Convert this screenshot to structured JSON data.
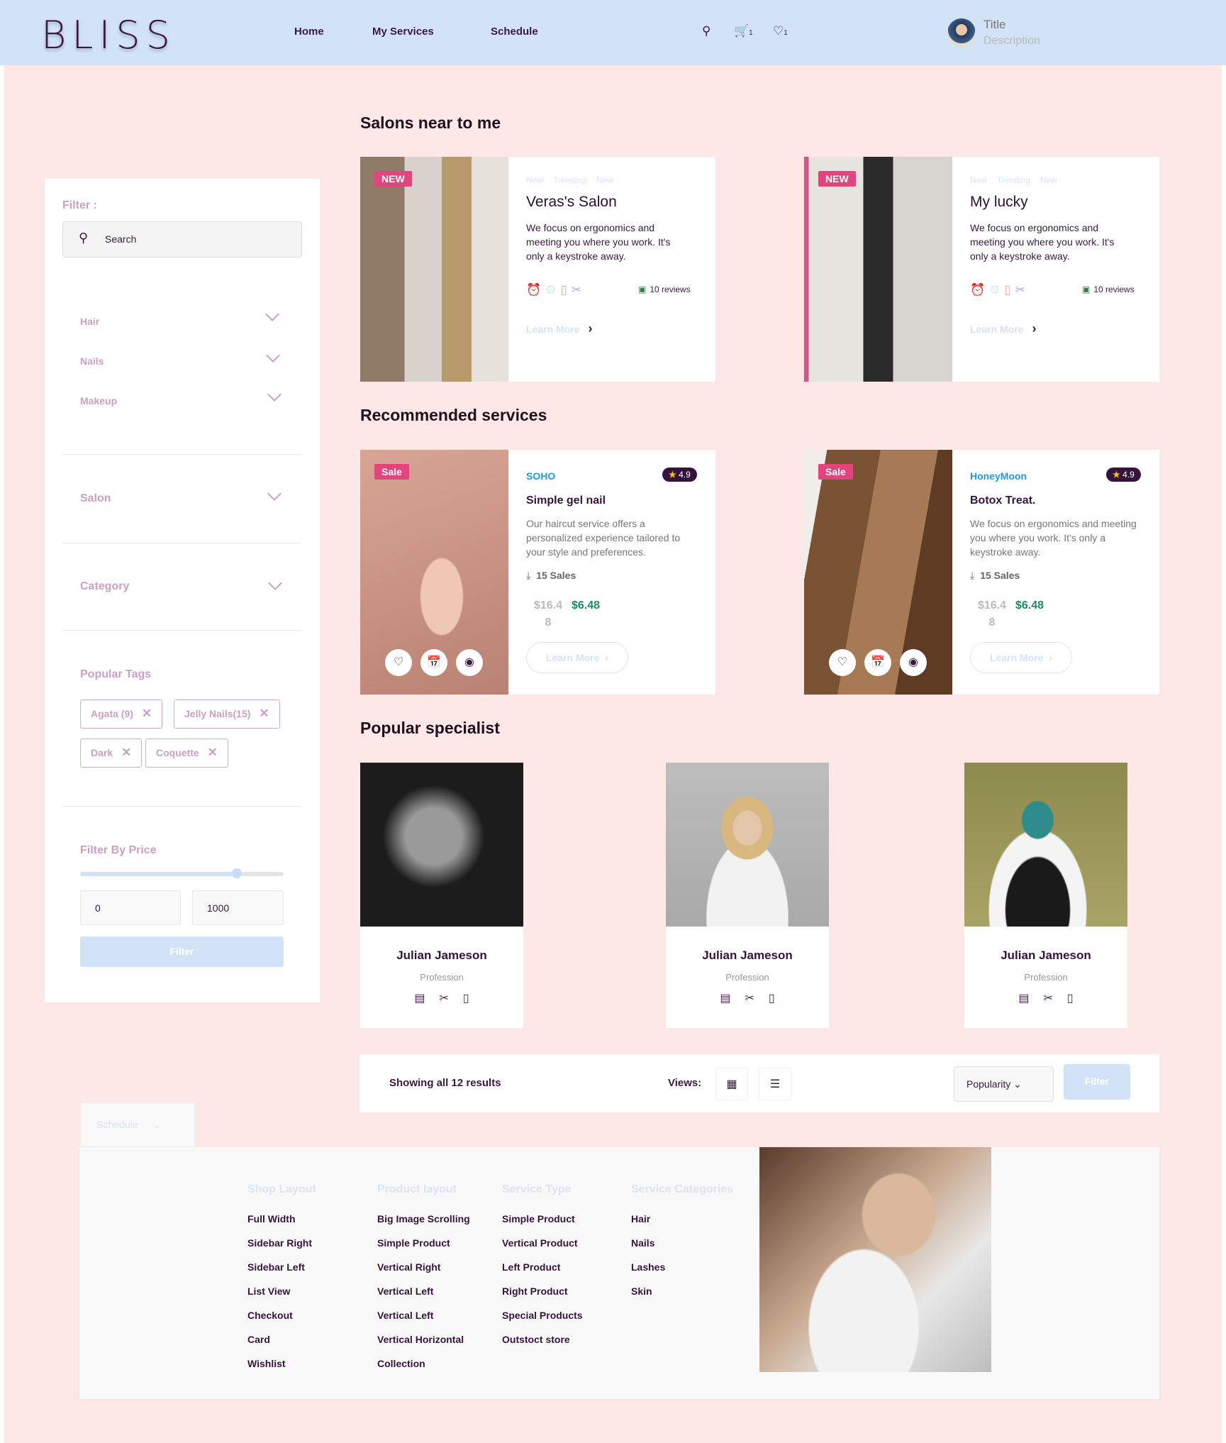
{
  "header": {
    "logo": "BLISS",
    "nav": [
      "Home",
      "My Services",
      "Schedule"
    ],
    "cart_count": "1",
    "wishlist_count": "1",
    "user_title": "Title",
    "user_description": "Description"
  },
  "sidebar": {
    "filter_label": "Filter :",
    "search_placeholder": "Search",
    "groups": [
      "Hair",
      "Nails",
      "Makeup"
    ],
    "salon": "Salon",
    "category": "Category",
    "popular_tags_label": "Popular Tags",
    "tags": [
      "Agata (9)",
      "Jelly Nails(15)",
      "Dark",
      "Coquette"
    ],
    "price_label": "Filter By Price",
    "price_fraction": 0.77,
    "min": "0",
    "max": "1000",
    "filter_button": "Filter"
  },
  "salons": {
    "heading": "Salons near to me",
    "items": [
      {
        "badge": "NEW",
        "tags": [
          "New",
          "Trending",
          "New"
        ],
        "name": "Veras's Salon",
        "description": "We focus on ergonomics and meeting you where you work. It's only a keystroke away.",
        "reviews": "10 reviews",
        "cta": "Learn More"
      },
      {
        "badge": "NEW",
        "tags": [
          "New",
          "Trending",
          "New"
        ],
        "name": "My lucky",
        "description": "We focus on ergonomics and meeting you where you work. It's only a keystroke away.",
        "reviews": "10 reviews",
        "cta": "Learn More"
      }
    ]
  },
  "services": {
    "heading": "Recommended services",
    "items": [
      {
        "badge": "Sale",
        "brand": "SOHO",
        "rating": "4.9",
        "name": "Simple gel nail",
        "description": "Our haircut service offers a personalized experience tailored to your style and preferences.",
        "sales": "15 Sales",
        "old_price": "$16.48",
        "price": "$6.48",
        "cta": "Learn More"
      },
      {
        "badge": "Sale",
        "brand": "HoneyMoon",
        "rating": "4.9",
        "name": "Botox Treat.",
        "description": "We focus on ergonomics and meeting you where you work. It's only a keystroke away.",
        "sales": "15 Sales",
        "old_price": "$16.48",
        "price": "$6.48",
        "cta": "Learn More"
      }
    ]
  },
  "specialists": {
    "heading": "Popular specialist",
    "items": [
      {
        "name": "Julian Jameson",
        "profession": "Profession"
      },
      {
        "name": "Julian Jameson",
        "profession": "Profession"
      },
      {
        "name": "Julian Jameson",
        "profession": "Profession"
      }
    ]
  },
  "toolbar": {
    "results": "Showing all 12 results",
    "views_label": "Views:",
    "sort": "Popularity",
    "filter_button": "Filter"
  },
  "schedule_dropdown": "Schedule",
  "footer": {
    "columns": [
      {
        "heading": "Shop Layout",
        "items": [
          "Full Width",
          "Sidebar Right",
          "Sidebar Left",
          "List View",
          "Checkout",
          "Card",
          "Wishlist"
        ]
      },
      {
        "heading": "Product layout",
        "items": [
          "Big Image Scrolling",
          "Simple Product",
          "Vertical Right",
          "Vertical Left",
          "Vertical Left",
          "Vertical Horizontal",
          "Collection"
        ]
      },
      {
        "heading": "Service Type",
        "items": [
          "Simple Product",
          "Vertical Product",
          "Left Product",
          "Right Product",
          "Special Products",
          "Outstoct store"
        ]
      },
      {
        "heading": "Service Categories",
        "items": [
          "Hair",
          "Nails",
          "Lashes",
          "Skin"
        ]
      }
    ]
  },
  "colors": {
    "header_bg": "#d2e3f8",
    "page_bg": "#fde7e7",
    "accent": "#e0457e",
    "brand_dark": "#36133c",
    "price_green": "#1f8a62"
  }
}
